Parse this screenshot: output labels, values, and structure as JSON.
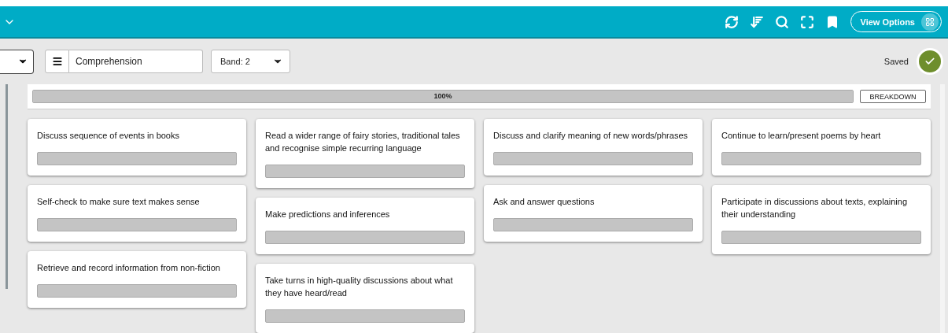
{
  "header": {
    "view_options": {
      "label": "View Options"
    }
  },
  "toolbar": {
    "subject": {
      "value": "Comprehension"
    },
    "band": {
      "value": "Band: 2"
    },
    "status": {
      "label": "Saved",
      "saved": true
    }
  },
  "progress": {
    "level": 1,
    "reading": "100%",
    "button": "BREAKDOWN"
  },
  "columns": [
    {
      "cards": [
        {
          "title": "Discuss sequence of events in books"
        },
        {
          "title": "Self-check to make sure text makes sense"
        },
        {
          "title": "Retrieve and record information from non-fiction"
        }
      ]
    },
    {
      "cards": [
        {
          "title": "Read a wider range of fairy stories, traditional tales and recognise simple recurring language"
        },
        {
          "title": "Make predictions and inferences"
        },
        {
          "title": "Take turns in high-quality discussions about what they have heard/read"
        }
      ]
    },
    {
      "cards": [
        {
          "title": "Discuss and clarify meaning of new words/phrases"
        },
        {
          "title": "Ask and answer questions"
        }
      ]
    },
    {
      "cards": [
        {
          "title": "Continue to learn/present poems by heart"
        },
        {
          "title": "Participate in discussions about texts, explaining their understanding"
        }
      ]
    }
  ]
}
